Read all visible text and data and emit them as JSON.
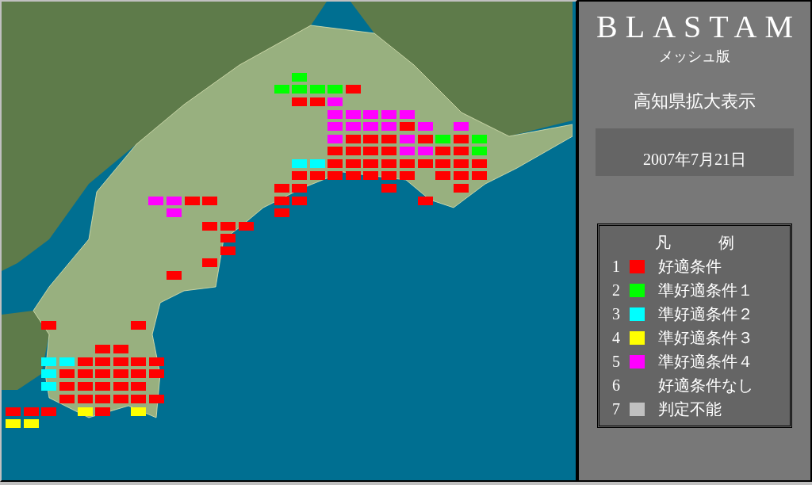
{
  "title": "BLASTAM",
  "subtitle": "メッシュ版",
  "view": "高知県拡大表示",
  "date": "2007年7月21日",
  "legend": {
    "heading": [
      "凡",
      "例"
    ],
    "items": [
      {
        "number": "1",
        "label": "好適条件",
        "color": "#ff0000"
      },
      {
        "number": "2",
        "label": "準好適条件１",
        "color": "#00ff00"
      },
      {
        "number": "3",
        "label": "準好適条件２",
        "color": "#00ffff"
      },
      {
        "number": "4",
        "label": "準好適条件３",
        "color": "#ffff00"
      },
      {
        "number": "5",
        "label": "準好適条件４",
        "color": "#ff00ff"
      },
      {
        "number": "6",
        "label": "好適条件なし"
      },
      {
        "number": "7",
        "label": "判定不能",
        "color": "#c0c0c0"
      }
    ]
  }
}
